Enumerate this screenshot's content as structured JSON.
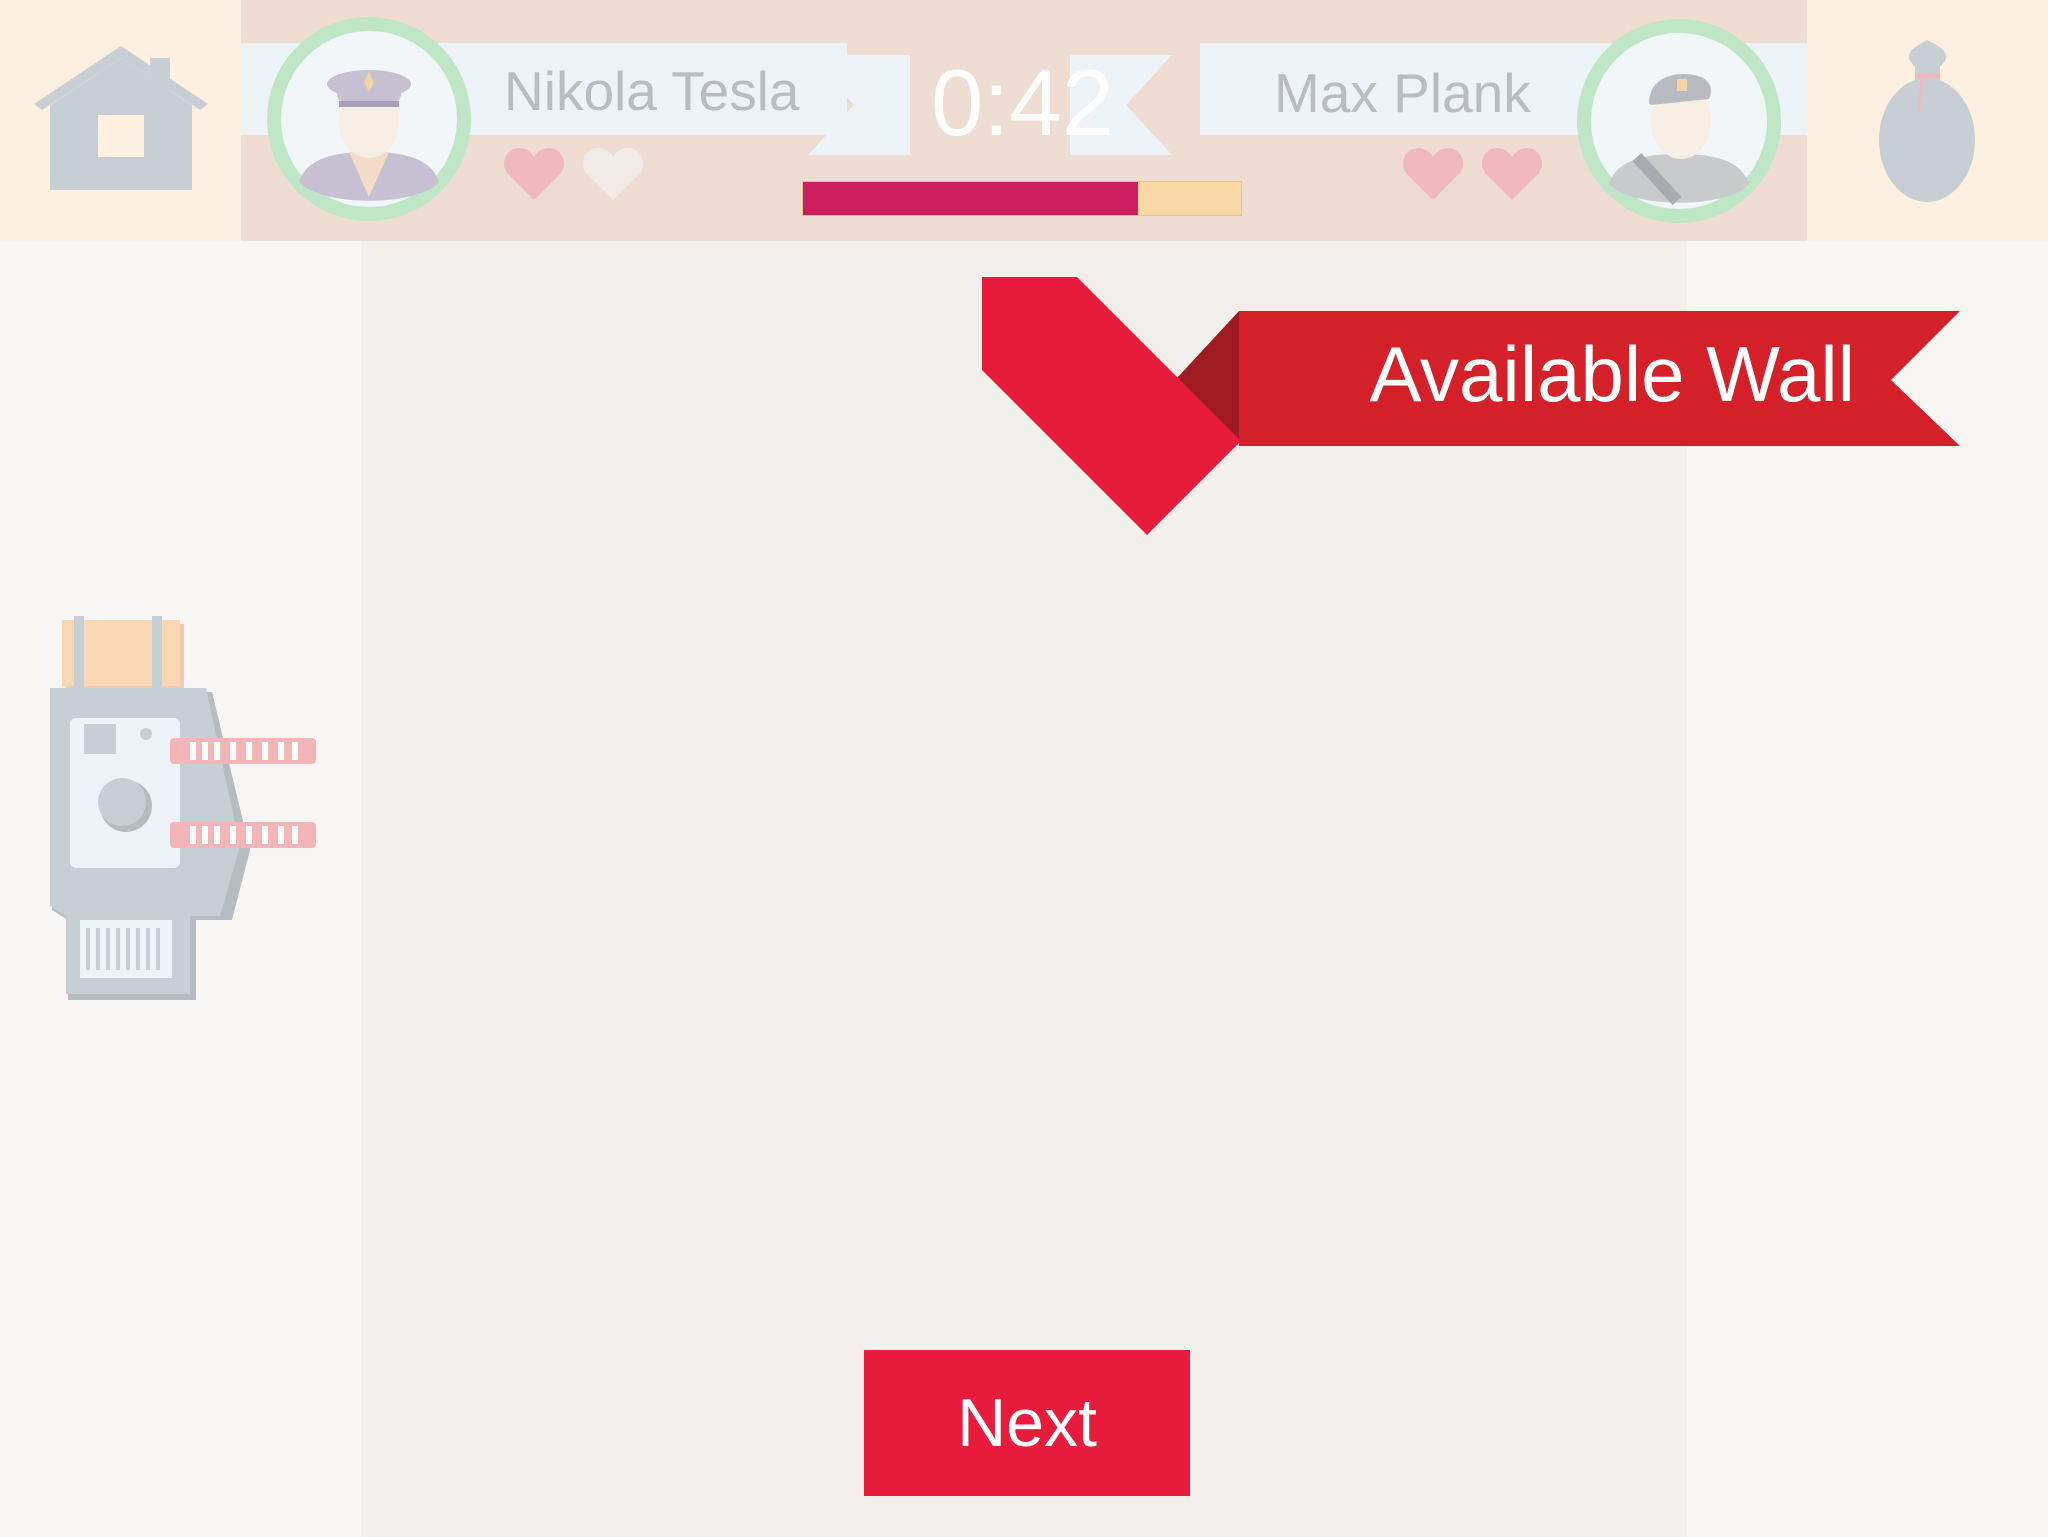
{
  "header": {
    "home_icon": "home-icon",
    "bag_icon": "money-bag-icon",
    "timer": "0:42",
    "progress": 0.765,
    "colors": {
      "progress_fill": "#cc1e5f",
      "progress_track": "#f8d8a5",
      "heart_full": "#f2b8c0",
      "heart_empty": "#f2ece9",
      "avatar_ring": "#bfe6c6"
    }
  },
  "players": [
    {
      "name": "Nikola Tesla",
      "avatar_icon": "officer-avatar-icon",
      "hearts_full": 1,
      "hearts_total": 2
    },
    {
      "name": "Max Plank",
      "avatar_icon": "soldier-avatar-icon",
      "hearts_full": 2,
      "hearts_total": 2
    }
  ],
  "banner": {
    "label": "Available Wall",
    "color": "#d42029",
    "accent": "#e71c3c"
  },
  "turret_icon": "turret-icon",
  "next_button": {
    "label": "Next",
    "color": "#e71c3c"
  }
}
